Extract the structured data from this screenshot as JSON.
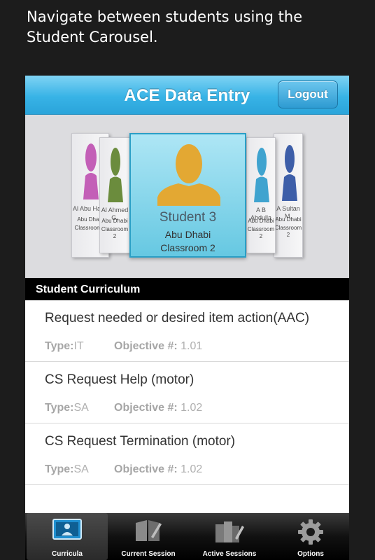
{
  "caption": "Navigate between students using the Student Carousel.",
  "header": {
    "title": "ACE Data Entry",
    "logout_label": "Logout"
  },
  "carousel": {
    "left_cards": [
      {
        "name": "Al Abu Hajar",
        "line1": "Abu Dhabi",
        "line2": "Classroom 1",
        "color": "#c35fb7"
      },
      {
        "name": "Al Ahmed G.",
        "line1": "Abu Dhabi",
        "line2": "Classroom 2",
        "color": "#6b8c3d"
      }
    ],
    "center_card": {
      "name": "Student 3",
      "line1": "Abu Dhabi",
      "line2": "Classroom 2",
      "color": "#e3a833"
    },
    "right_cards": [
      {
        "name": "A B Abdulla",
        "line1": "Abu Dhabi",
        "line2": "Classroom 2",
        "color": "#3fa3cf"
      },
      {
        "name": "A Sultan M.",
        "line1": "Abu Dhabi",
        "line2": "Classroom 2",
        "color": "#3d5ea8"
      }
    ]
  },
  "section": {
    "title": "Student Curriculum"
  },
  "curriculum": [
    {
      "title": "Request needed or desired item action(AAC)",
      "type_label": "Type:",
      "type": "IT",
      "objective_label": "Objective #:",
      "objective": "1.01"
    },
    {
      "title": "CS Request Help (motor)",
      "type_label": "Type:",
      "type": "SA",
      "objective_label": "Objective #:",
      "objective": "1.02"
    },
    {
      "title": "CS Request Termination (motor)",
      "type_label": "Type:",
      "type": "SA",
      "objective_label": "Objective #:",
      "objective": "1.02"
    }
  ],
  "tabs": [
    {
      "label": "Curricula",
      "icon": "id-card-icon",
      "active": true
    },
    {
      "label": "Current Session",
      "icon": "book-icon",
      "active": false
    },
    {
      "label": "Active Sessions",
      "icon": "books-icon",
      "active": false
    },
    {
      "label": "Options",
      "icon": "gear-icon",
      "active": false
    }
  ]
}
